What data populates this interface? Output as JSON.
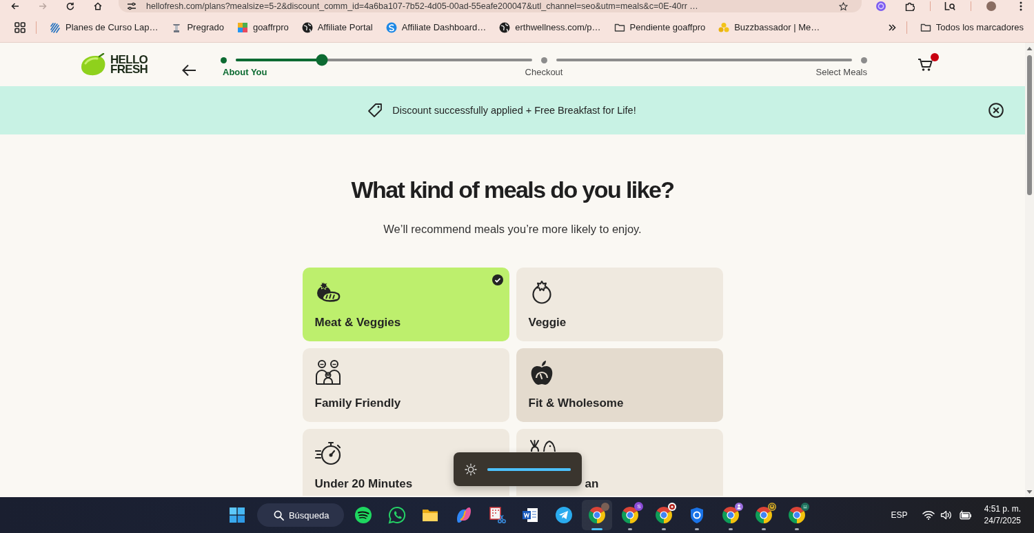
{
  "browser": {
    "url": "hellofresh.com/plans?mealsize=5-2&discount_comm_id=4a6ba107-7b52-4d05-00ad-55eafe200047&utl_channel=seo&utm=meals&c=0E-40rr …",
    "bookmarks": [
      {
        "label": "Planes de Curso Lap…",
        "kind": "site"
      },
      {
        "label": "Pregrado",
        "kind": "site"
      },
      {
        "label": "goaffrpro",
        "kind": "site"
      },
      {
        "label": "Affiliate Portal",
        "kind": "site"
      },
      {
        "label": "Affiliate Dashboard…",
        "kind": "site"
      },
      {
        "label": "erthwellness.com/p…",
        "kind": "site"
      },
      {
        "label": "Pendiente goaffpro",
        "kind": "folder"
      },
      {
        "label": "Buzzbassador | Me…",
        "kind": "site"
      }
    ],
    "all_bookmarks": "Todos los marcadores"
  },
  "header": {
    "logo": "HELLO FRESH",
    "steps": [
      {
        "label": "About You",
        "selected": true
      },
      {
        "label": "Checkout",
        "selected": false
      },
      {
        "label": "Select Meals",
        "selected": false
      }
    ],
    "segments": [
      {
        "level": 0.29
      },
      {
        "level": 0
      }
    ],
    "cart": {
      "badge": true
    }
  },
  "banner": {
    "text": "Discount successfully applied + Free Breakfast for Life!"
  },
  "title": "What kind of meals do you like?",
  "subtitle": "We’ll recommend meals you’re more likely to enjoy.",
  "options": [
    {
      "label": "Meat & Veggies",
      "selected": true,
      "hovered": false
    },
    {
      "label": "Veggie",
      "selected": false,
      "hovered": false
    },
    {
      "label": "Family Friendly",
      "selected": false,
      "hovered": false
    },
    {
      "label": "Fit & Wholesome",
      "selected": false,
      "hovered": true
    },
    {
      "label": "Under 20 Minutes",
      "selected": false,
      "hovered": false
    },
    {
      "label": "an",
      "selected": false,
      "hovered": false
    }
  ],
  "brightness": {
    "level": 1
  },
  "taskbar": {
    "search": "Búsqueda",
    "apps": [
      {
        "running": false,
        "selected": false
      },
      {
        "running": false,
        "selected": false
      },
      {
        "running": false,
        "selected": false
      },
      {
        "running": false,
        "selected": false
      },
      {
        "running": false,
        "selected": false
      },
      {
        "running": false,
        "selected": false
      },
      {
        "running": false,
        "selected": false
      },
      {
        "running": true,
        "selected": true
      },
      {
        "running": true,
        "selected": false,
        "badge": "S"
      },
      {
        "running": true,
        "selected": false
      },
      {
        "running": true,
        "selected": false
      },
      {
        "running": true,
        "selected": false
      },
      {
        "running": true,
        "selected": false
      },
      {
        "running": true,
        "selected": false
      }
    ],
    "tray": {
      "language": "ESP",
      "time": "4:51 p. m.",
      "date": "24/7/2025"
    }
  }
}
